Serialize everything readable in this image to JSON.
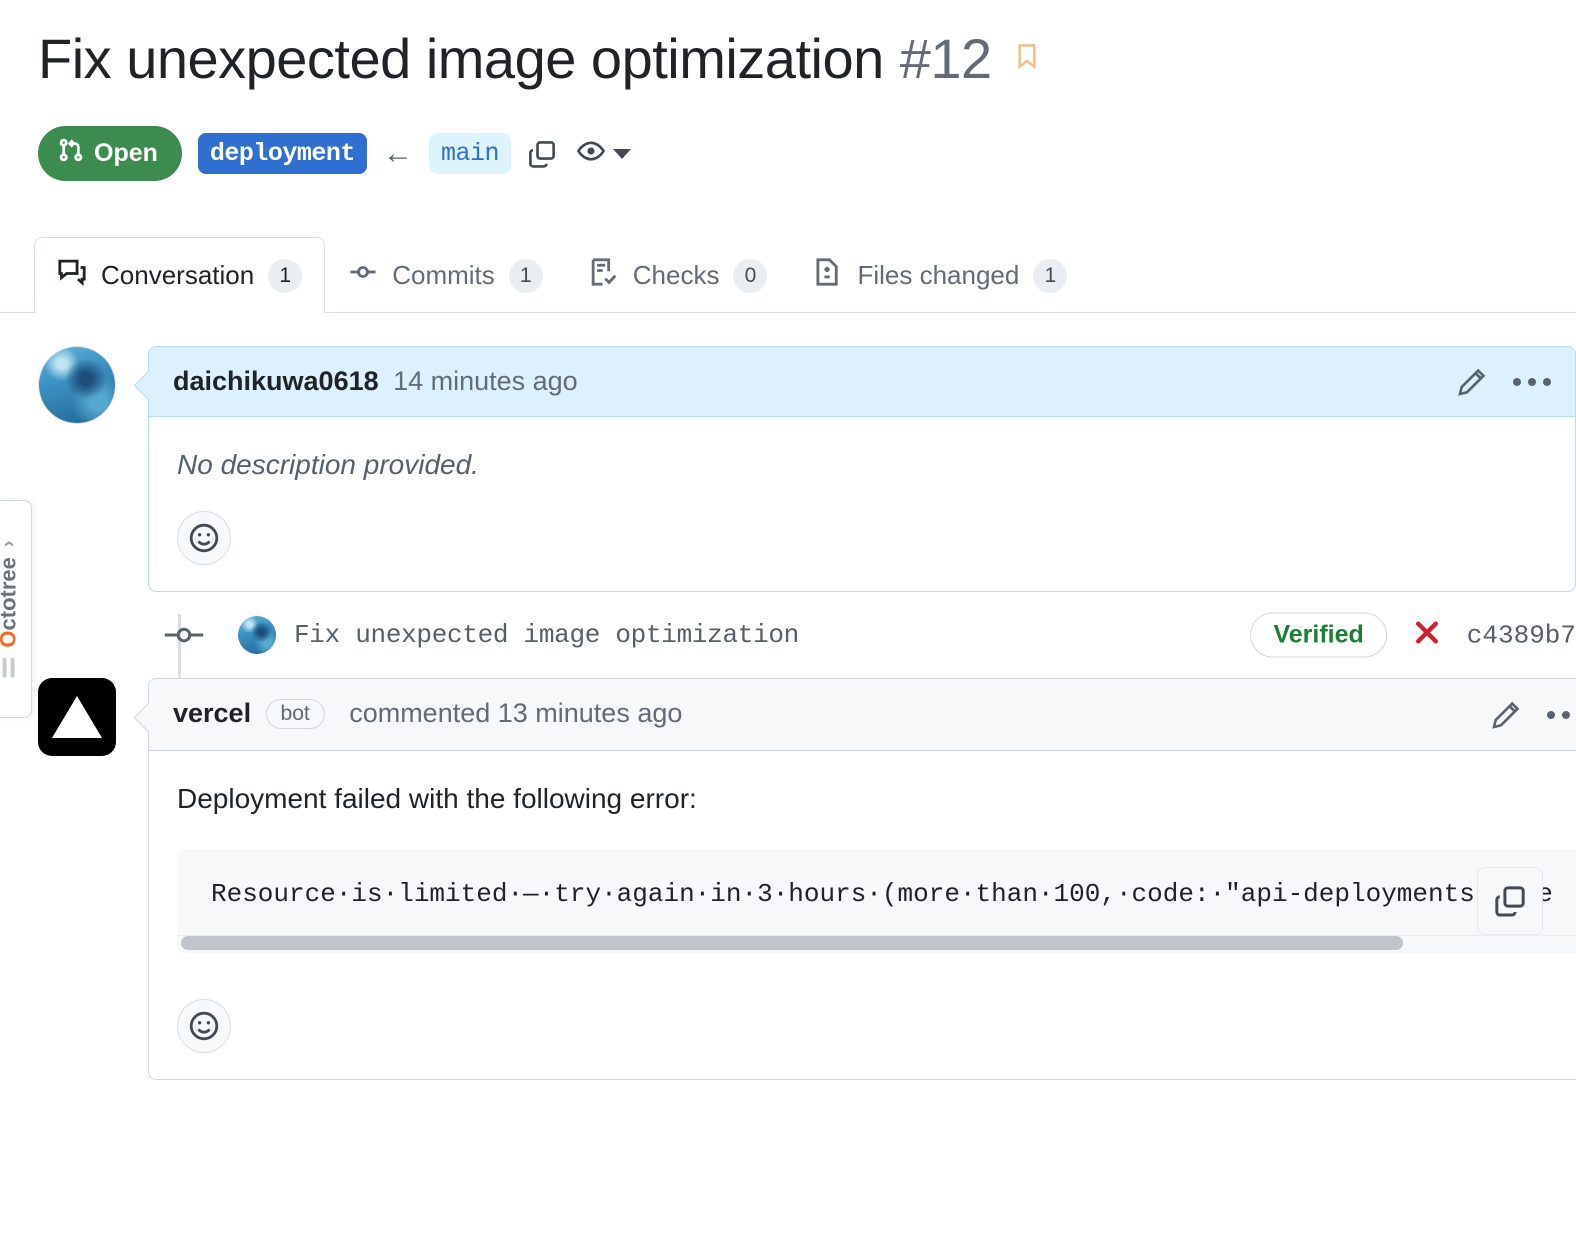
{
  "header": {
    "title": "Fix unexpected image optimization",
    "number": "#12",
    "bookmark_icon": "bookmark-icon",
    "bookmark_color": "#eac28c"
  },
  "status": {
    "state_label": "Open",
    "state_color": "#3b8c4e",
    "state_icon": "git-pull-request-icon",
    "head_branch": "deployment",
    "head_branch_color": "#2f6fd0",
    "arrow": "←",
    "base_branch": "main",
    "base_branch_color": "#ddf4ff",
    "copy_icon": "copy-icon",
    "watch_icon": "eye-icon",
    "caret_icon": "chevron-down-icon"
  },
  "tabs": [
    {
      "label": "Conversation",
      "count": "1",
      "icon": "comment-discussion-icon",
      "active": true
    },
    {
      "label": "Commits",
      "count": "1",
      "icon": "git-commit-icon",
      "active": false
    },
    {
      "label": "Checks",
      "count": "0",
      "icon": "checklist-icon",
      "active": false
    },
    {
      "label": "Files changed",
      "count": "1",
      "icon": "file-diff-icon",
      "active": false
    }
  ],
  "comments": [
    {
      "author": "daichikuwa0618",
      "meta": "14 minutes ago",
      "body": "No description provided.",
      "edit_icon": "pencil-icon",
      "menu_icon": "kebab-horizontal-icon",
      "reaction_icon": "smiley-icon"
    },
    {
      "author": "vercel",
      "bot_label": "bot",
      "meta": "commented 13 minutes ago",
      "body": "Deployment failed with the following error:",
      "code": "Resource·is·limited·—·try·again·in·3·hours·(more·than·100,·code:·\"api-deployments-free",
      "code_tail": "-",
      "copy_icon": "copy-icon",
      "edit_icon": "pencil-icon",
      "menu_icon": "kebab-horizontal-icon",
      "reaction_icon": "smiley-icon"
    }
  ],
  "commit": {
    "message": "Fix unexpected image optimization",
    "verified_label": "Verified",
    "verified_color": "#1a7f37",
    "status_icon": "x-failure-icon",
    "status_color": "#cf222e",
    "sha": "c4389b7"
  },
  "octotree": {
    "label_prefix": "O",
    "label_rest": "ctotree",
    "chevron": "›",
    "accent_color": "#f26b26"
  }
}
